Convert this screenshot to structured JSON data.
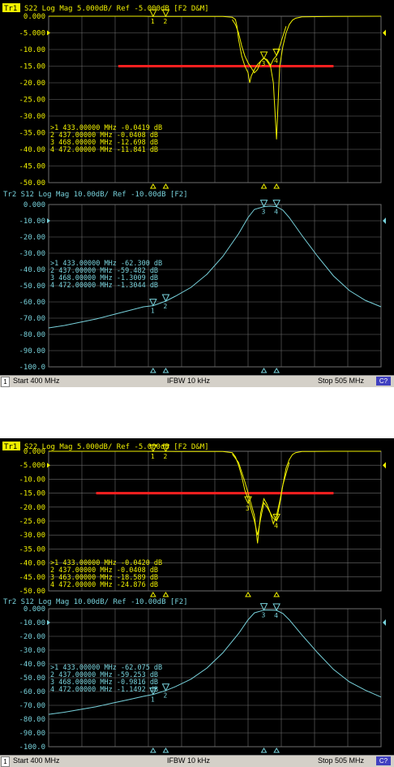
{
  "colors": {
    "background": "#000000",
    "grid": "#6e6e6e",
    "trace1": "#f0f000",
    "trace2": "#78d2dc",
    "limit_line": "#ff2020",
    "status_bar": "#d4d0c8"
  },
  "screens": [
    {
      "status": {
        "channel": "1",
        "start": "Start 400 MHz",
        "ifbw": "IFBW 10 kHz",
        "stop": "Stop 505 MHz",
        "cont_icon": "C?"
      },
      "chart_data": [
        {
          "type": "line",
          "title": "Tr1 S22 Log Mag 5.000dB/ Ref -5.000dB [F2 D&M]",
          "tr_badge": "Tr1",
          "title_rest": "S22 Log Mag 5.000dB/ Ref -5.000dB [F2 D&M]",
          "xlim": [
            400,
            505
          ],
          "ylim": [
            -50,
            0
          ],
          "y_ticks": [
            "0.000",
            "-5.000",
            "-10.00",
            "-15.00",
            "-20.00",
            "-25.00",
            "-30.00",
            "-35.00",
            "-40.00",
            "-45.00",
            "-50.00"
          ],
          "grid": true,
          "limit_line": {
            "x": [
              422,
              490
            ],
            "y": [
              -15,
              -15
            ]
          },
          "series": [
            {
              "x": [
                400,
                420,
                430,
                433,
                437,
                440,
                450,
                455,
                458,
                459,
                459.5,
                460,
                461,
                462,
                463,
                463.5,
                464,
                465,
                466,
                467,
                468,
                469,
                470,
                471,
                472,
                473,
                474,
                475,
                476,
                477,
                478,
                480,
                490,
                505
              ],
              "y": [
                0,
                0,
                0,
                -0.04,
                -0.04,
                -0.05,
                -0.06,
                -0.08,
                -0.3,
                -1.0,
                -3.0,
                -7.0,
                -12,
                -15,
                -17,
                -20,
                -18,
                -16,
                -14.5,
                -13.5,
                -12.7,
                -13,
                -14.5,
                -20,
                -37,
                -15,
                -9,
                -5,
                -2.5,
                -1.2,
                -0.6,
                -0.2,
                -0.05,
                0
              ]
            },
            {
              "x": [
                458,
                459,
                460,
                461,
                462,
                463,
                464,
                465,
                466,
                467,
                468,
                469,
                470,
                471,
                472,
                473,
                474,
                475
              ],
              "y": [
                -1,
                -2.5,
                -5,
                -9,
                -12,
                -14,
                -15.5,
                -17,
                -16,
                -13.5,
                -12.5,
                -13.5,
                -15,
                -13,
                -11.8,
                -9,
                -6,
                -3
              ]
            }
          ],
          "markers": [
            {
              "label": "1",
              "x": 433,
              "y": -0.0419,
              "value_label": "433.00000 MHz -0.0419 dB"
            },
            {
              "label": "2",
              "x": 437,
              "y": -0.0408,
              "value_label": "437.00000 MHz -0.0408 dB"
            },
            {
              "label": "3",
              "x": 468,
              "y": -12.698,
              "value_label": "468.00000 MHz -12.698 dB"
            },
            {
              "label": "4",
              "x": 472,
              "y": -11.841,
              "value_label": "472.00000 MHz -11.841 dB"
            }
          ]
        },
        {
          "type": "line",
          "title": "Tr2 S12 Log Mag 10.00dB/ Ref -10.00dB [F2]",
          "tr_badge": "",
          "title_rest": "Tr2 S12 Log Mag 10.00dB/ Ref -10.00dB [F2]",
          "xlim": [
            400,
            505
          ],
          "ylim": [
            -100,
            0
          ],
          "y_ticks": [
            "0.000",
            "-10.00",
            "-20.00",
            "-30.00",
            "-40.00",
            "-50.00",
            "-60.00",
            "-70.00",
            "-80.00",
            "-90.00",
            "-100.0"
          ],
          "grid": true,
          "series": [
            {
              "x": [
                400,
                405,
                410,
                415,
                420,
                425,
                430,
                433,
                437,
                440,
                445,
                450,
                455,
                460,
                463,
                465,
                468,
                470,
                472,
                474,
                476,
                480,
                485,
                490,
                495,
                500,
                505
              ],
              "y": [
                -76,
                -74.5,
                -72.5,
                -70.5,
                -68,
                -65.5,
                -63,
                -62.3,
                -59.5,
                -56.5,
                -51,
                -43,
                -32,
                -18,
                -8,
                -3,
                -1.3,
                -1.0,
                -1.3,
                -3.5,
                -8,
                -19,
                -32,
                -44,
                -53,
                -59,
                -63
              ]
            }
          ],
          "markers": [
            {
              "label": "1",
              "x": 433,
              "y": -62.3,
              "value_label": "433.00000 MHz -62.300 dB"
            },
            {
              "label": "2",
              "x": 437,
              "y": -59.482,
              "value_label": "437.00000 MHz -59.482 dB"
            },
            {
              "label": "3",
              "x": 468,
              "y": -1.3009,
              "value_label": "468.00000 MHz -1.3009 dB"
            },
            {
              "label": "4",
              "x": 472,
              "y": -1.3044,
              "value_label": "472.00000 MHz -1.3044 dB"
            }
          ]
        }
      ]
    },
    {
      "status": {
        "channel": "1",
        "start": "Start 400 MHz",
        "ifbw": "IFBW 10 kHz",
        "stop": "Stop 505 MHz",
        "cont_icon": "C?"
      },
      "chart_data": [
        {
          "type": "line",
          "title": "Tr1 S22 Log Mag 5.000dB/ Ref -5.000dB [F2 D&M]",
          "tr_badge": "Tr1",
          "title_rest": "S22 Log Mag 5.000dB/ Ref -5.000dB [F2 D&M]",
          "xlim": [
            400,
            505
          ],
          "ylim": [
            -50,
            0
          ],
          "y_ticks": [
            "0.000",
            "-5.000",
            "-10.00",
            "-15.00",
            "-20.00",
            "-25.00",
            "-30.00",
            "-35.00",
            "-40.00",
            "-45.00",
            "-50.00"
          ],
          "grid": true,
          "limit_line": {
            "x": [
              415,
              490
            ],
            "y": [
              -15,
              -15
            ]
          },
          "series": [
            {
              "x": [
                400,
                420,
                430,
                433,
                437,
                440,
                450,
                455,
                458,
                459,
                460,
                461,
                462,
                463,
                464,
                465,
                466,
                467,
                468,
                469,
                470,
                471,
                472,
                473,
                474,
                475,
                476,
                477,
                478,
                480,
                490,
                505
              ],
              "y": [
                0,
                0,
                0,
                -0.04,
                -0.04,
                -0.05,
                -0.06,
                -0.1,
                -0.5,
                -2,
                -5,
                -9,
                -14,
                -17,
                -21,
                -25,
                -30,
                -24,
                -18.5,
                -20,
                -22,
                -24,
                -24.9,
                -19,
                -12,
                -6,
                -3,
                -1.2,
                -0.5,
                -0.1,
                0,
                0
              ]
            },
            {
              "x": [
                458,
                460,
                462,
                464,
                465,
                466,
                467,
                468,
                469,
                470,
                471,
                472,
                473,
                474,
                476
              ],
              "y": [
                -1,
                -4,
                -11,
                -19,
                -23,
                -33,
                -22,
                -17,
                -19,
                -22,
                -26,
                -23,
                -18,
                -12,
                -4
              ]
            }
          ],
          "markers": [
            {
              "label": "1",
              "x": 433,
              "y": -0.042,
              "value_label": "433.00000 MHz -0.0420 dB"
            },
            {
              "label": "2",
              "x": 437,
              "y": -0.0408,
              "value_label": "437.00000 MHz -0.0408 dB"
            },
            {
              "label": "3",
              "x": 463,
              "y": -18.589,
              "value_label": "463.00000 MHz -18.589 dB"
            },
            {
              "label": "4",
              "x": 472,
              "y": -24.876,
              "value_label": "472.00000 MHz -24.876 dB"
            }
          ]
        },
        {
          "type": "line",
          "title": "Tr2 S12 Log Mag 10.00dB/ Ref -10.00dB [F2]",
          "tr_badge": "",
          "title_rest": "Tr2 S12 Log Mag 10.00dB/ Ref -10.00dB [F2]",
          "xlim": [
            400,
            505
          ],
          "ylim": [
            -100,
            0
          ],
          "y_ticks": [
            "0.000",
            "-10.00",
            "-20.00",
            "-30.00",
            "-40.00",
            "-50.00",
            "-60.00",
            "-70.00",
            "-80.00",
            "-90.00",
            "-100.0"
          ],
          "grid": true,
          "series": [
            {
              "x": [
                400,
                405,
                410,
                415,
                420,
                425,
                430,
                433,
                437,
                440,
                445,
                450,
                455,
                460,
                463,
                465,
                468,
                470,
                472,
                474,
                476,
                480,
                485,
                490,
                495,
                500,
                505
              ],
              "y": [
                -76.5,
                -75,
                -73,
                -71,
                -68.5,
                -66,
                -63.5,
                -62.1,
                -59.3,
                -56.5,
                -51,
                -43,
                -32,
                -18,
                -8,
                -3,
                -0.98,
                -1.0,
                -1.15,
                -3.5,
                -8,
                -19,
                -32,
                -44,
                -53,
                -59,
                -64
              ]
            }
          ],
          "markers": [
            {
              "label": "1",
              "x": 433,
              "y": -62.075,
              "value_label": "433.00000 MHz -62.075 dB"
            },
            {
              "label": "2",
              "x": 437,
              "y": -59.253,
              "value_label": "437.00000 MHz -59.253 dB"
            },
            {
              "label": "3",
              "x": 468,
              "y": -0.9816,
              "value_label": "468.00000 MHz -0.9816 dB"
            },
            {
              "label": "4",
              "x": 472,
              "y": -1.1492,
              "value_label": "472.00000 MHz -1.1492 dB"
            }
          ]
        }
      ]
    }
  ]
}
